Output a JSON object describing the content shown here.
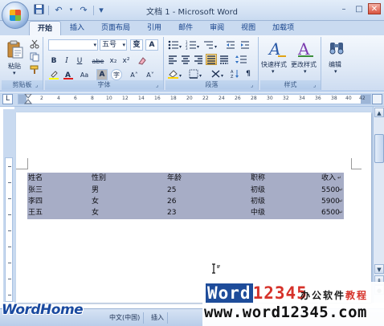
{
  "window": {
    "title": "文档 1 - Microsoft Word",
    "controls": {
      "minimize": "–",
      "restore": "□",
      "close": "✕"
    }
  },
  "quick_access": {
    "save_icon": "floppy-icon",
    "undo_glyph": "↶",
    "redo_glyph": "↷",
    "customize_glyph": "▾"
  },
  "tabs": [
    {
      "label": "开始",
      "active": true
    },
    {
      "label": "插入"
    },
    {
      "label": "页面布局"
    },
    {
      "label": "引用"
    },
    {
      "label": "邮件"
    },
    {
      "label": "审阅"
    },
    {
      "label": "视图"
    },
    {
      "label": "加载项"
    }
  ],
  "ribbon": {
    "clipboard": {
      "label": "剪贴板",
      "paste_label": "粘贴"
    },
    "font": {
      "label": "字体",
      "font_name": "",
      "font_size": "五号",
      "font_size_glyph": "变",
      "font_a": "A",
      "bold": "B",
      "italic": "I",
      "underline": "U",
      "strike": "abe",
      "subscript": "x₂",
      "superscript": "x²",
      "change_case": "Aa",
      "char_shading": "A",
      "enclose": "字",
      "grow": "A˄",
      "shrink": "A˅"
    },
    "paragraph": {
      "label": "段落"
    },
    "styles": {
      "label": "样式",
      "quick_styles": "快速样式",
      "change_styles": "更改样式"
    },
    "editing": {
      "label": "编辑"
    }
  },
  "ruler": {
    "tab_glyph": "L",
    "numbers": [
      "2",
      "4",
      "6",
      "8",
      "10",
      "12",
      "14",
      "16",
      "18",
      "20",
      "22",
      "24",
      "26",
      "28",
      "30",
      "32",
      "34",
      "36",
      "38",
      "40",
      "42"
    ]
  },
  "table": {
    "header": [
      "姓名",
      "性别",
      "年龄",
      "职称",
      "收入"
    ],
    "rows": [
      [
        "张三",
        "男",
        "25",
        "初级",
        "5500"
      ],
      [
        "李四",
        "女",
        "26",
        "初级",
        "5900"
      ],
      [
        "王五",
        "女",
        "23",
        "中级",
        "6500"
      ]
    ],
    "cell_mark": "↵"
  },
  "status": {
    "language": "中文(中国)",
    "mode": "插入"
  },
  "watermark": {
    "left": "WordHome",
    "brand_word": "Word",
    "brand_digits": "12345",
    "brand_cn": "办公软件",
    "brand_cn_red": "教程",
    "url": "www.word12345.com"
  },
  "colors": {
    "ribbon_bg": "#dfe9f6",
    "table_highlight": "#a7adc6",
    "brand_blue": "#1e4c9a",
    "brand_red": "#d6322a"
  }
}
